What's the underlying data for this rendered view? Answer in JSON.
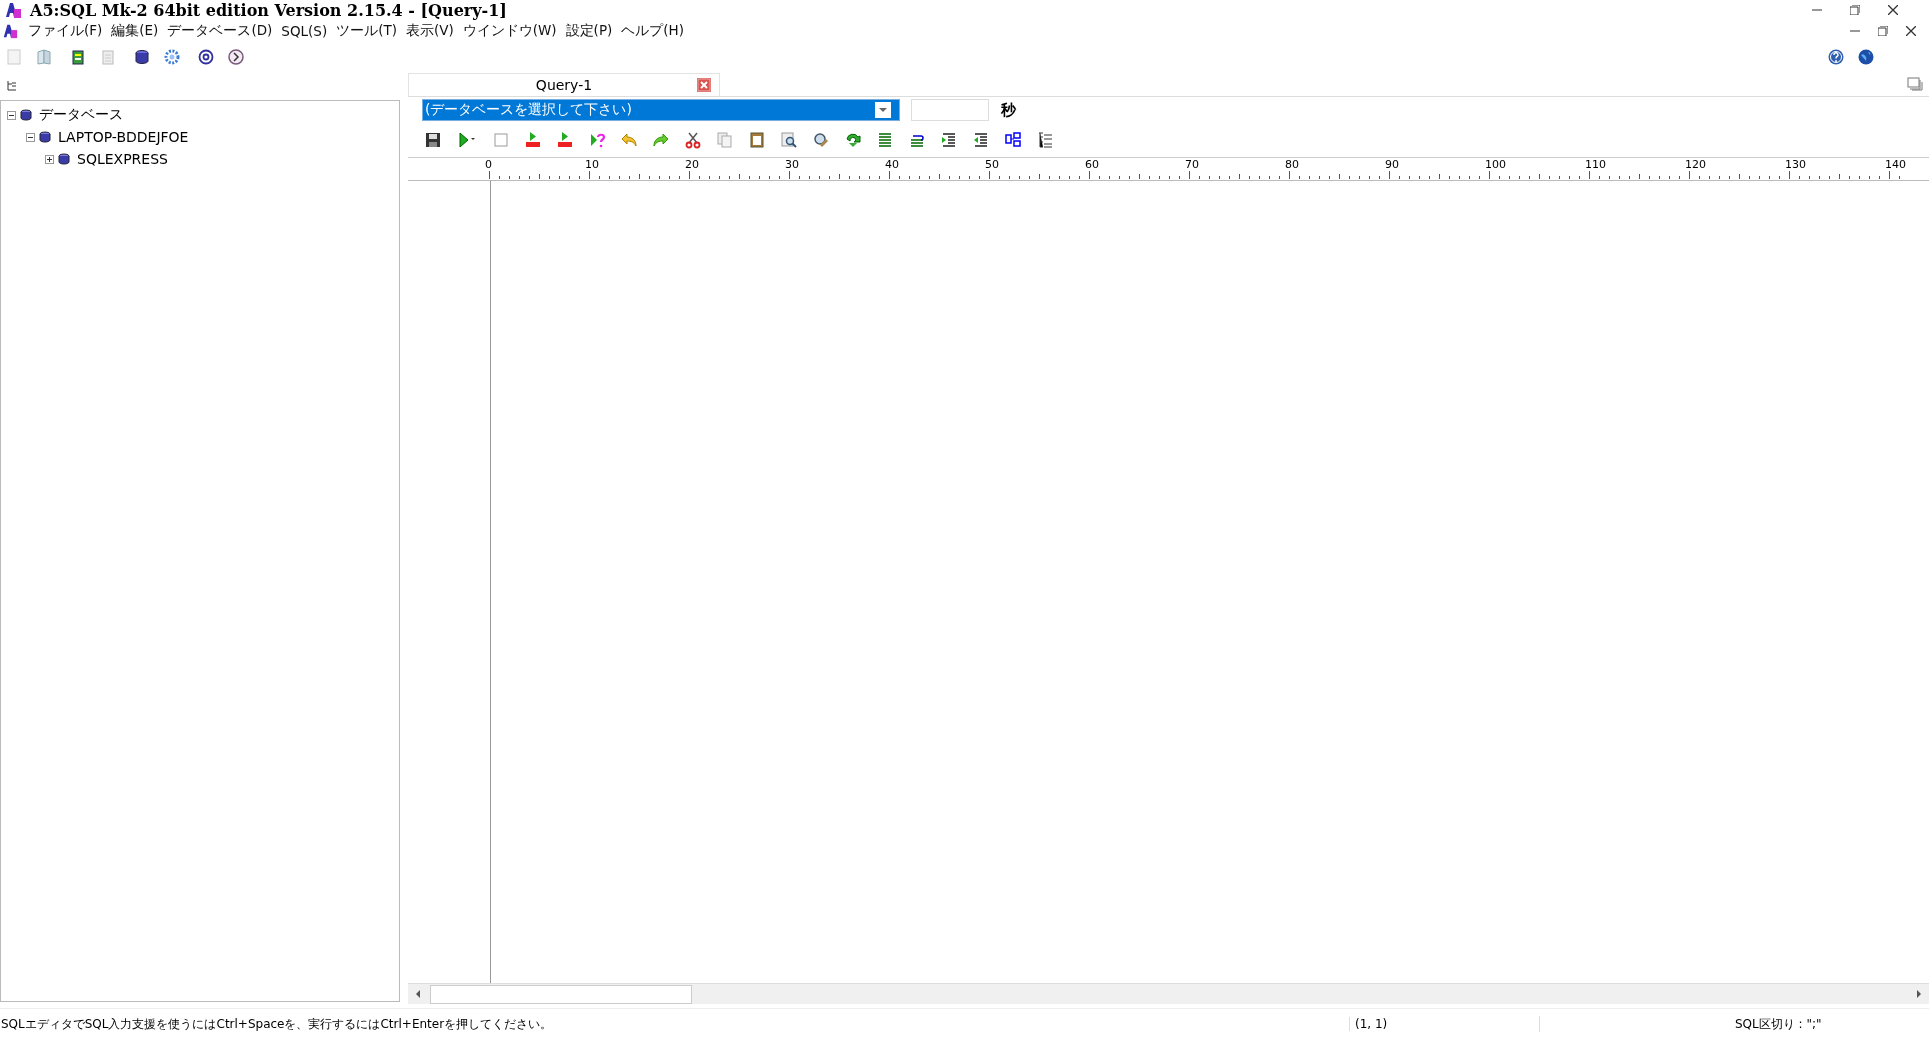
{
  "window": {
    "title": "A5:SQL Mk-2 64bit edition Version 2.15.4 - [Query-1]"
  },
  "menu": [
    {
      "label": "ファイル(F)"
    },
    {
      "label": "編集(E)"
    },
    {
      "label": "データベース(D)"
    },
    {
      "label": "SQL(S)"
    },
    {
      "label": "ツール(T)"
    },
    {
      "label": "表示(V)"
    },
    {
      "label": "ウインドウ(W)"
    },
    {
      "label": "設定(P)"
    },
    {
      "label": "ヘルプ(H)"
    }
  ],
  "tree": [
    {
      "label": "データベース",
      "expanded": true,
      "children": [
        {
          "label": "LAPTOP-BDDEJFOE",
          "expanded": true,
          "children": [
            {
              "label": "SQLEXPRESS",
              "expanded": false
            }
          ]
        }
      ]
    }
  ],
  "tabs": [
    {
      "label": "Query-1",
      "selected": true
    }
  ],
  "database_select": {
    "value": "(データベースを選択して下さい)"
  },
  "timeout": {
    "unit": "秒"
  },
  "ruler": {
    "labels": [
      "0",
      "10",
      "20",
      "30",
      "40",
      "50",
      "60",
      "70",
      "80",
      "90",
      "100",
      "110",
      "120",
      "130",
      "140"
    ]
  },
  "status_bar": {
    "message": "SQLエディタでSQL入力支援を使うにはCtrl+Spaceを、実行するにはCtrl+Enterを押してください。",
    "position": "(1, 1)",
    "delimiter": "SQL区切り : \";\""
  }
}
